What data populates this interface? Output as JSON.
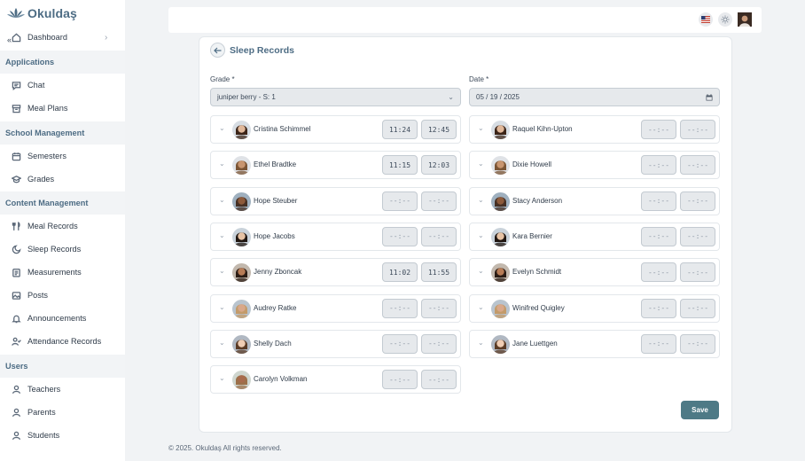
{
  "app": {
    "name": "Okuldaş",
    "collapse_icon": "«"
  },
  "sidebar": {
    "dashboard": "Dashboard",
    "sections": {
      "applications": "Applications",
      "school_management": "School Management",
      "content_management": "Content Management",
      "users": "Users"
    },
    "items": {
      "chat": "Chat",
      "meal_plans": "Meal Plans",
      "semesters": "Semesters",
      "grades": "Grades",
      "meal_records": "Meal Records",
      "sleep_records": "Sleep Records",
      "measurements": "Measurements",
      "posts": "Posts",
      "announcements": "Announcements",
      "attendance_records": "Attendance Records",
      "teachers": "Teachers",
      "parents": "Parents",
      "students": "Students"
    }
  },
  "page": {
    "title": "Sleep Records",
    "grade_label": "Grade *",
    "grade_value": "juniper berry - S: 1",
    "date_label": "Date *",
    "date_value": "05 / 19 / 2025",
    "save_label": "Save"
  },
  "students_left": [
    {
      "name": "Cristina Schimmel",
      "start": "11:24",
      "end": "12:45"
    },
    {
      "name": "Ethel Bradtke",
      "start": "11:15",
      "end": "12:03"
    },
    {
      "name": "Hope Steuber",
      "start": "--:--",
      "end": "--:--"
    },
    {
      "name": "Hope Jacobs",
      "start": "--:--",
      "end": "--:--"
    },
    {
      "name": "Jenny Zboncak",
      "start": "11:02",
      "end": "11:55"
    },
    {
      "name": "Audrey Ratke",
      "start": "--:--",
      "end": "--:--"
    },
    {
      "name": "Shelly Dach",
      "start": "--:--",
      "end": "--:--"
    },
    {
      "name": "Carolyn Volkman",
      "start": "--:--",
      "end": "--:--"
    }
  ],
  "students_right": [
    {
      "name": "Raquel Kihn-Upton",
      "start": "--:--",
      "end": "--:--"
    },
    {
      "name": "Dixie Howell",
      "start": "--:--",
      "end": "--:--"
    },
    {
      "name": "Stacy Anderson",
      "start": "--:--",
      "end": "--:--"
    },
    {
      "name": "Kara Bernier",
      "start": "--:--",
      "end": "--:--"
    },
    {
      "name": "Evelyn Schmidt",
      "start": "--:--",
      "end": "--:--"
    },
    {
      "name": "Winifred Quigley",
      "start": "--:--",
      "end": "--:--"
    },
    {
      "name": "Jane Luettgen",
      "start": "--:--",
      "end": "--:--"
    }
  ],
  "footer": "© 2025. Okuldaş All rights reserved.",
  "colors": {
    "accent": "#4d6c84",
    "save": "#4e7a86"
  }
}
